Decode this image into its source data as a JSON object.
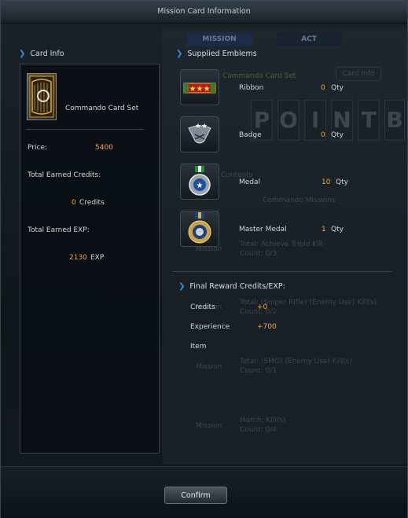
{
  "window": {
    "title": "Mission Card Information"
  },
  "background": {
    "tab_mission": "MISSION",
    "tab_act": "ACT",
    "commando_card_set": "Commando Card Set",
    "card_info_button": "Card Info",
    "letters": [
      "P",
      "O",
      "I",
      "N",
      "T",
      "B"
    ],
    "contents": "Contents",
    "commando_missions": "Commando Missions",
    "missions": [
      {
        "label": "Mission",
        "title": "Total: Achieve Triple Kill",
        "count": "Count: 0/3"
      },
      {
        "label": "Mission",
        "title": "Total: (Sniper Rifle) (Enemy Use) Kill(s)",
        "count": "Count: 0/2"
      },
      {
        "label": "Mission",
        "title": "Total: (SMG) (Enemy Use) Kill(s)",
        "count": "Count: 0/1"
      },
      {
        "label": "Mission",
        "title": "Match: Kill(s)",
        "count": "Count: 0/4"
      }
    ]
  },
  "card_info": {
    "heading": "Card Info",
    "card_name": "Commando Card Set",
    "price_label": "Price:",
    "price_value": "5400",
    "credits_label": "Total Earned Credits:",
    "credits_value": "0",
    "credits_unit": "Credits",
    "exp_label": "Total Earned EXP:",
    "exp_value": "2130",
    "exp_unit": "EXP"
  },
  "emblems": {
    "heading": "Supplied Emblems",
    "items": [
      {
        "name": "Ribbon",
        "qty": "0",
        "unit": "Qty",
        "icon": "ribbon-icon"
      },
      {
        "name": "Badge",
        "qty": "0",
        "unit": "Qty",
        "icon": "badge-icon"
      },
      {
        "name": "Medal",
        "qty": "10",
        "unit": "Qty",
        "icon": "medal-icon"
      },
      {
        "name": "Master Medal",
        "qty": "1",
        "unit": "Qty",
        "icon": "master-medal-icon"
      }
    ]
  },
  "final_reward": {
    "heading": "Final Reward Credits/EXP:",
    "credits_label": "Credits",
    "credits_value": "+0",
    "experience_label": "Experience",
    "experience_value": "+700",
    "item_label": "Item"
  },
  "footer": {
    "confirm_label": "Confirm"
  },
  "colors": {
    "accent": "#3a8fe0",
    "value": "#f0a53a"
  }
}
